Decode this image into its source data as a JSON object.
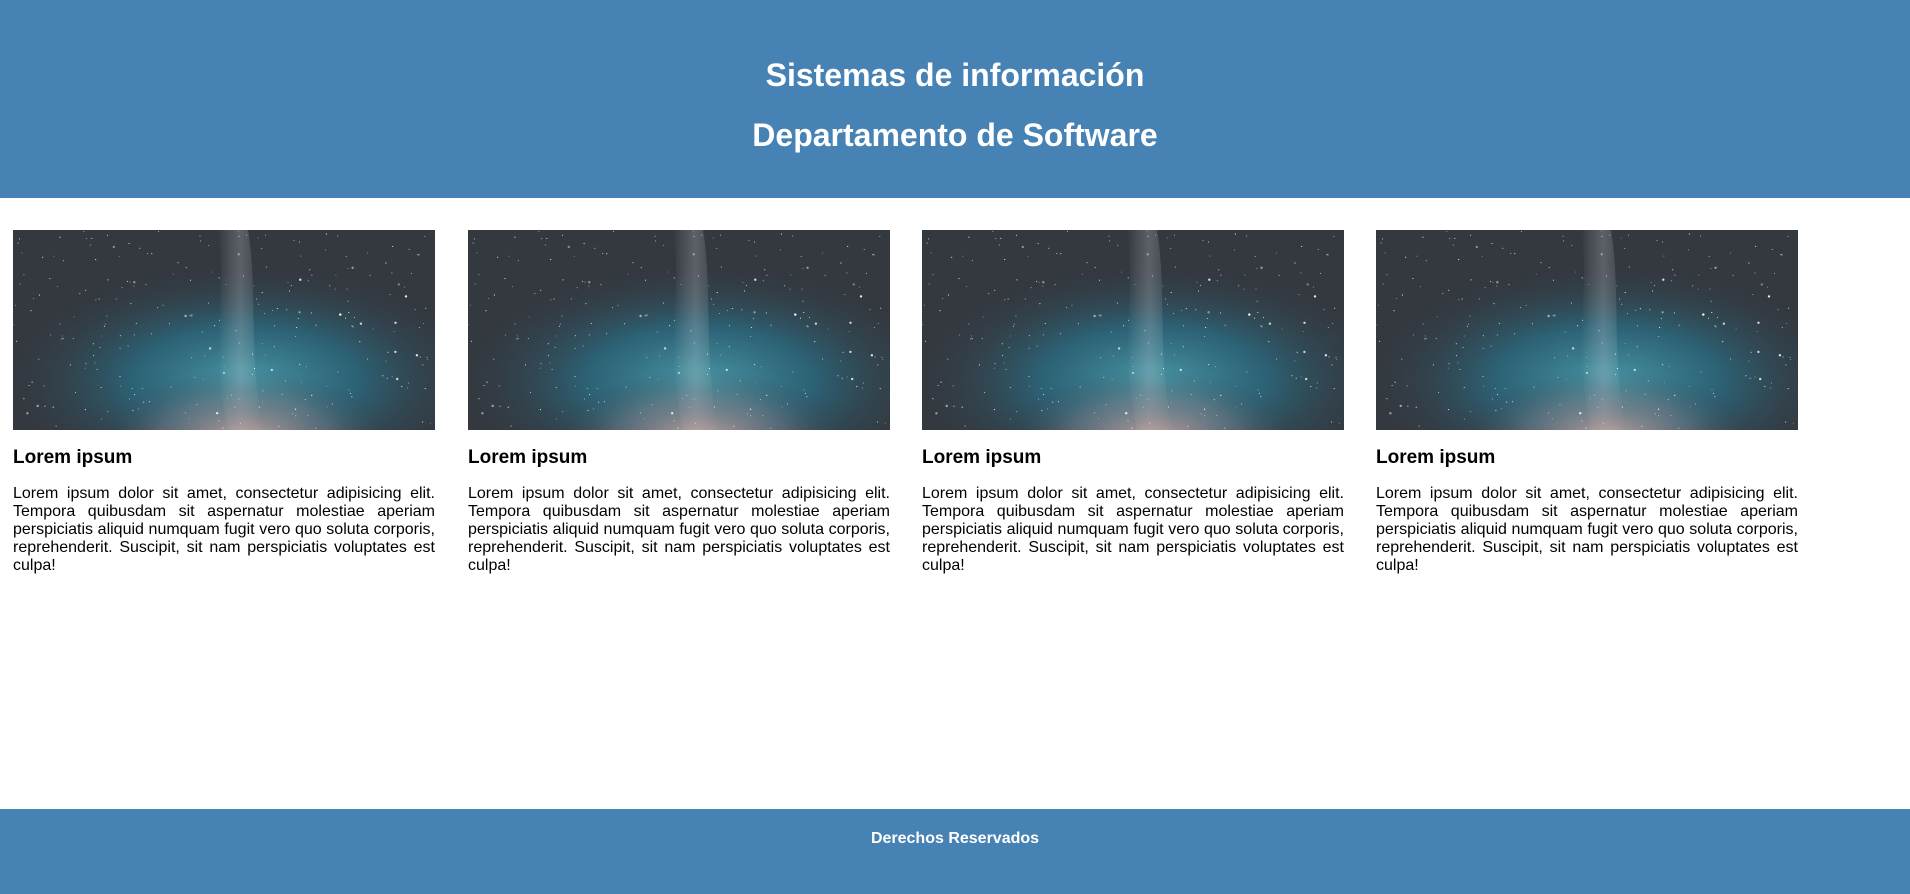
{
  "header": {
    "title": "Sistemas de información",
    "subtitle": "Departamento de Software"
  },
  "cards": [
    {
      "image_alt": "galaxy-image",
      "title": "Lorem ipsum",
      "text": "Lorem ipsum dolor sit amet, consectetur adipisicing elit. Tempora quibusdam sit aspernatur molestiae aperiam perspiciatis aliquid numquam fugit vero quo soluta corporis, reprehenderit. Suscipit, sit nam perspiciatis voluptates est culpa!"
    },
    {
      "image_alt": "galaxy-image",
      "title": "Lorem ipsum",
      "text": "Lorem ipsum dolor sit amet, consectetur adipisicing elit. Tempora quibusdam sit aspernatur molestiae aperiam perspiciatis aliquid numquam fugit vero quo soluta corporis, reprehenderit. Suscipit, sit nam perspiciatis voluptates est culpa!"
    },
    {
      "image_alt": "galaxy-image",
      "title": "Lorem ipsum",
      "text": "Lorem ipsum dolor sit amet, consectetur adipisicing elit. Tempora quibusdam sit aspernatur molestiae aperiam perspiciatis aliquid numquam fugit vero quo soluta corporis, reprehenderit. Suscipit, sit nam perspiciatis voluptates est culpa!"
    },
    {
      "image_alt": "galaxy-image",
      "title": "Lorem ipsum",
      "text": "Lorem ipsum dolor sit amet, consectetur adipisicing elit. Tempora quibusdam sit aspernatur molestiae aperiam perspiciatis aliquid numquam fugit vero quo soluta corporis, reprehenderit. Suscipit, sit nam perspiciatis voluptates est culpa!"
    }
  ],
  "footer": {
    "text": "Derechos Reservados"
  },
  "colors": {
    "header_bg": "#4682b4",
    "footer_bg": "#4682b4",
    "header_text": "#ffffff"
  }
}
